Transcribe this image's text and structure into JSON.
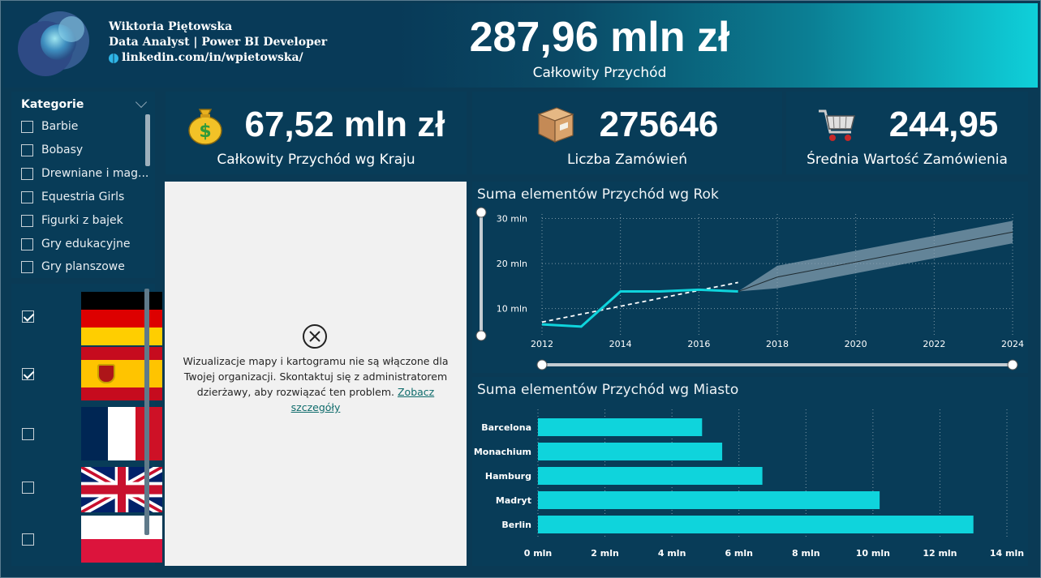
{
  "header": {
    "author_name": "Wiktoria Piętowska",
    "author_role": "Data Analyst | Power BI Developer",
    "author_link": "linkedin.com/in/wpietowska/",
    "total_revenue": "287,96 mln zł",
    "total_revenue_label": "Całkowity Przychód"
  },
  "kpis": [
    {
      "value": "67,52 mln zł",
      "label": "Całkowity Przychód wg Kraju",
      "icon": "money-bag-icon"
    },
    {
      "value": "275646",
      "label": "Liczba Zamówień",
      "icon": "package-icon"
    },
    {
      "value": "244,95",
      "label": "Średnia Wartość Zamówienia",
      "icon": "shopping-cart-icon"
    }
  ],
  "category_slicer": {
    "title": "Kategorie",
    "items": [
      {
        "label": "Barbie",
        "checked": false
      },
      {
        "label": "Bobasy",
        "checked": false
      },
      {
        "label": "Drewniane i mag...",
        "checked": false
      },
      {
        "label": "Equestria Girls",
        "checked": false
      },
      {
        "label": "Figurki z bajek",
        "checked": false
      },
      {
        "label": "Gry edukacyjne",
        "checked": false
      },
      {
        "label": "Gry planszowe",
        "checked": false
      }
    ]
  },
  "country_slicer": {
    "items": [
      {
        "flag": "germany-flag",
        "checked": true
      },
      {
        "flag": "spain-flag",
        "checked": true
      },
      {
        "flag": "france-flag",
        "checked": false
      },
      {
        "flag": "uk-flag",
        "checked": false
      },
      {
        "flag": "poland-flag",
        "checked": false
      }
    ]
  },
  "map": {
    "error_text": "Wizualizacje mapy i kartogramu nie są włączone dla Twojej organizacji. Skontaktuj się z administratorem dzierżawy, aby rozwiązać ten problem.",
    "link_text": "Zobacz szczegóły"
  },
  "colors": {
    "accent": "#0fd4dc",
    "background": "#0a3a55",
    "card": "#083c58"
  },
  "chart_data": [
    {
      "type": "line",
      "title": "Suma elementów Przychód wg Rok",
      "x": [
        2012,
        2013,
        2014,
        2015,
        2016,
        2017
      ],
      "values": [
        6.5,
        6.0,
        13.8,
        13.8,
        14.2,
        13.8
      ],
      "trend": {
        "x": [
          2012,
          2017
        ],
        "values": [
          7.0,
          15.8
        ]
      },
      "forecast": {
        "x": [
          2017,
          2018,
          2024
        ],
        "values": [
          13.8,
          17.0,
          27.0
        ],
        "upper": [
          13.8,
          19.5,
          29.5
        ],
        "lower": [
          13.8,
          14.5,
          24.5
        ]
      },
      "xticks": [
        "2012",
        "2014",
        "2016",
        "2018",
        "2020",
        "2022",
        "2024"
      ],
      "yticks": [
        "10 mln",
        "20 mln",
        "30 mln"
      ],
      "xlim": [
        2012,
        2024
      ],
      "ylim": [
        4,
        31
      ],
      "grid": true
    },
    {
      "type": "bar",
      "orientation": "horizontal",
      "title": "Suma elementów Przychód wg Miasto",
      "categories": [
        "Barcelona",
        "Monachium",
        "Hamburg",
        "Madryt",
        "Berlin"
      ],
      "values": [
        4.9,
        5.5,
        6.7,
        10.2,
        13.0
      ],
      "xticks": [
        "0 mln",
        "2 mln",
        "4 mln",
        "6 mln",
        "8 mln",
        "10 mln",
        "12 mln",
        "14 mln"
      ],
      "xlim": [
        0,
        14
      ],
      "grid": true
    }
  ]
}
